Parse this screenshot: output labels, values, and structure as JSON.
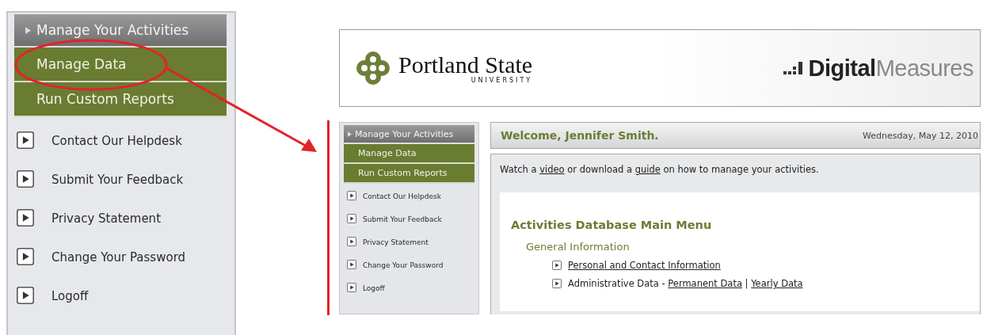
{
  "zoom_panel": {
    "menu_header": "Manage Your Activities",
    "submenu": [
      {
        "label": "Manage Data",
        "circled": true
      },
      {
        "label": "Run Custom Reports",
        "circled": false
      }
    ],
    "links": [
      "Contact Our Helpdesk",
      "Submit Your Feedback",
      "Privacy Statement",
      "Change Your Password",
      "Logoff"
    ]
  },
  "app": {
    "logo": {
      "name": "Portland State",
      "subtitle": "UNIVERSITY"
    },
    "vendor_logo": {
      "bold": "Digital",
      "light": "Measures"
    },
    "sidebar": {
      "menu_header": "Manage Your Activities",
      "submenu": [
        "Manage Data",
        "Run Custom Reports"
      ],
      "links": [
        "Contact Our Helpdesk",
        "Submit Your Feedback",
        "Privacy Statement",
        "Change Your Password",
        "Logoff"
      ]
    },
    "welcome": "Welcome, Jennifer Smith.",
    "date": "Wednesday, May 12, 2010",
    "intro": [
      {
        "kind": "text",
        "text": "Watch a "
      },
      {
        "kind": "link",
        "text": "video"
      },
      {
        "kind": "text",
        "text": " or download a "
      },
      {
        "kind": "link",
        "text": "guide"
      },
      {
        "kind": "text",
        "text": " on how to manage your activities."
      }
    ],
    "main_menu": {
      "title": "Activities Database Main Menu",
      "sections": [
        {
          "heading": "General Information",
          "entries": [
            [
              {
                "kind": "link",
                "text": "Personal and Contact Information"
              }
            ],
            [
              {
                "kind": "text",
                "text": "Administrative Data - "
              },
              {
                "kind": "link",
                "text": "Permanent Data"
              },
              {
                "kind": "text",
                "text": " | "
              },
              {
                "kind": "link",
                "text": "Yearly Data"
              }
            ]
          ]
        }
      ]
    }
  }
}
